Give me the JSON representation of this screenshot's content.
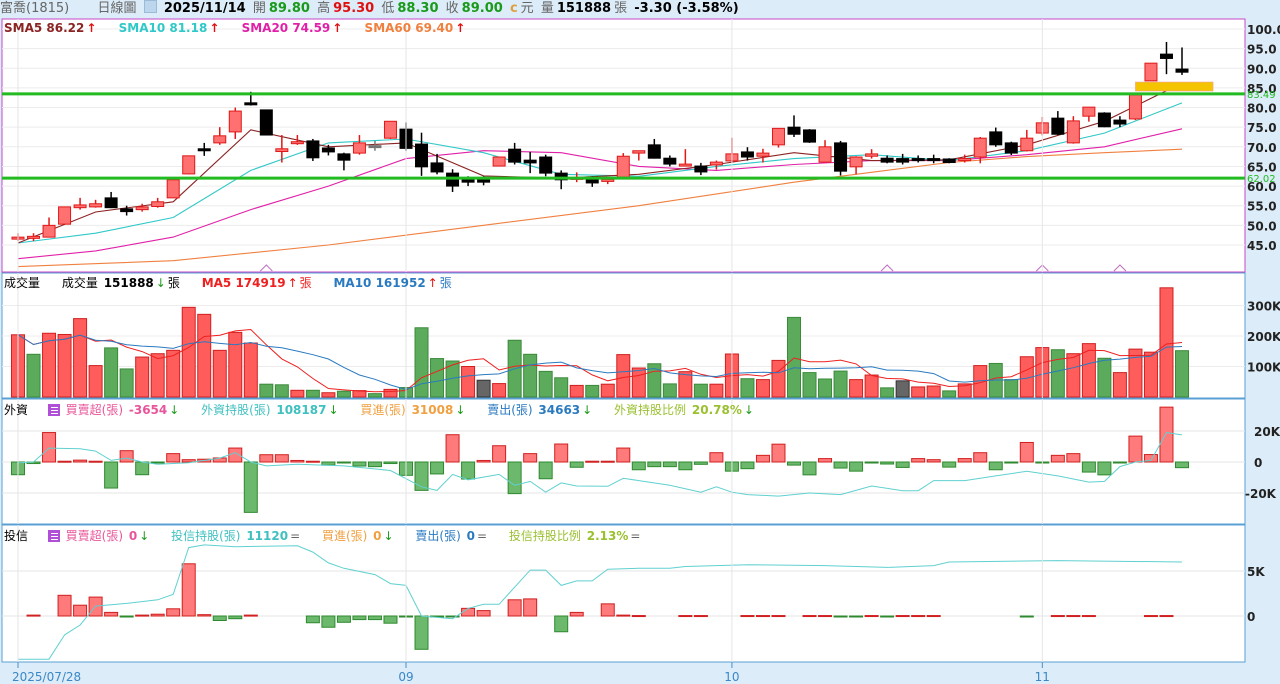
{
  "header": {
    "stock": "富喬(1815)",
    "chart_type": "日線圖",
    "date": "2025/11/14",
    "open_label": "開",
    "open": "89.80",
    "high_label": "高",
    "high": "95.30",
    "low_label": "低",
    "low": "88.30",
    "close_label": "收",
    "close": "89.00",
    "c_mark": "c",
    "unit": "元",
    "volume_label": "量",
    "volume": "151888",
    "volume_unit": "張",
    "change": "-3.30 (-3.58%)"
  },
  "price_legend": {
    "sma5": "SMA5 86.22",
    "sma5_arrow": "↑",
    "sma10": "SMA10 81.18",
    "sma10_arrow": "↑",
    "sma20": "SMA20 74.59",
    "sma20_arrow": "↑",
    "sma60": "SMA60 69.40",
    "sma60_arrow": "↑"
  },
  "volume_legend": {
    "title": "成交量",
    "label": "成交量",
    "value": "151888",
    "arrow": "↓",
    "unit": "張",
    "ma5": "MA5 174919",
    "ma5_arrow": "↑",
    "ma5_unit": "張",
    "ma10": "MA10 161952",
    "ma10_arrow": "↑",
    "ma10_unit": "張"
  },
  "foreign_legend": {
    "title": "外資",
    "net_label": "買賣超(張)",
    "net": "-3654",
    "net_arrow": "↓",
    "hold_label": "外資持股(張)",
    "hold": "108187",
    "hold_arrow": "↓",
    "buy_label": "買進(張)",
    "buy": "31008",
    "buy_arrow": "↓",
    "sell_label": "賣出(張)",
    "sell": "34663",
    "sell_arrow": "↓",
    "ratio_label": "外資持股比例",
    "ratio": "20.78%",
    "ratio_arrow": "↓"
  },
  "trust_legend": {
    "title": "投信",
    "net_label": "買賣超(張)",
    "net": "0",
    "net_arrow": "↓",
    "hold_label": "投信持股(張)",
    "hold": "11120",
    "hold_arrow": "=",
    "buy_label": "買進(張)",
    "buy": "0",
    "buy_arrow": "↓",
    "sell_label": "賣出(張)",
    "sell": "0",
    "sell_arrow": "=",
    "ratio_label": "投信持股比例",
    "ratio": "2.13%",
    "ratio_arrow": "="
  },
  "colors": {
    "up": "#ff7070",
    "up_border": "#e01818",
    "down": "#000000",
    "vol_up": "#ff5c5c",
    "vol_down": "#5cab5c",
    "vol_flat": "#666666",
    "sma5": "#8b2323",
    "sma10": "#30c8c8",
    "sma20": "#e020a8",
    "sma60": "#f08040",
    "support": "#22bb22",
    "zone": "#f5c400",
    "vma5": "#ee2020",
    "vma10": "#2a7ac0",
    "foreign_line": "#60d0d0",
    "trust_line": "#60d0d0"
  },
  "chart_data": {
    "type": "candlestick",
    "x_labels": [
      {
        "label": "2025/07/28",
        "candle": 1
      },
      {
        "label": "09",
        "candle": 26
      },
      {
        "label": "10",
        "candle": 47
      },
      {
        "label": "11",
        "candle": 67
      }
    ],
    "price_ticks": [
      "100.0",
      "95.0",
      "90.0",
      "85.0",
      "80.0",
      "75.0",
      "70.0",
      "65.0",
      "60.0",
      "55.0",
      "50.0",
      "45.0"
    ],
    "ylim": [
      40.3,
      101.5
    ],
    "support_lines": [
      {
        "label": "83.49",
        "value": 83.49
      },
      {
        "label": "62.02",
        "value": 62.02
      }
    ],
    "zone": {
      "from_candle": 73,
      "to_candle": 78,
      "low": 84.2,
      "high": 86.5
    },
    "markers": [
      17,
      57,
      67,
      72
    ],
    "ohlc": [
      [
        46.5,
        48,
        46,
        47
      ],
      [
        46.8,
        48,
        46,
        47.2
      ],
      [
        47,
        52,
        47,
        50
      ],
      [
        50.3,
        54.7,
        50.3,
        54.7
      ],
      [
        54.5,
        57,
        54,
        55.2
      ],
      [
        54.7,
        56.5,
        54.5,
        55.5
      ],
      [
        57,
        58.5,
        54.4,
        54.5
      ],
      [
        54.2,
        55,
        52.5,
        53.5
      ],
      [
        54,
        55.5,
        53.5,
        54.7
      ],
      [
        54.8,
        57,
        54.5,
        56
      ],
      [
        57,
        61.6,
        57,
        61.6
      ],
      [
        63.1,
        67.7,
        63,
        67.7
      ],
      [
        69.5,
        71,
        67.7,
        69.3
      ],
      [
        71,
        75,
        70.5,
        72.8
      ],
      [
        73.8,
        80,
        72,
        79.1
      ],
      [
        81.2,
        84,
        80.5,
        81
      ],
      [
        79.4,
        79.4,
        73,
        73
      ],
      [
        68.8,
        73,
        66,
        69.5
      ],
      [
        70.8,
        73,
        70.5,
        71.3
      ],
      [
        71.5,
        72,
        66.4,
        67.2
      ],
      [
        69.7,
        70.5,
        67.8,
        68.7
      ],
      [
        68.2,
        68.5,
        64,
        66.6
      ],
      [
        68.4,
        73,
        68,
        71
      ],
      [
        70.3,
        71.5,
        69,
        70.3
      ],
      [
        72.2,
        76.5,
        72,
        76.5
      ],
      [
        74.5,
        76.2,
        69,
        69.6
      ],
      [
        70.7,
        73.6,
        62.6,
        64.9
      ],
      [
        65.9,
        68.2,
        63,
        63.6
      ],
      [
        63.3,
        64.3,
        58.5,
        60
      ],
      [
        62,
        62.5,
        60,
        61
      ],
      [
        62.2,
        62.5,
        60.2,
        61
      ],
      [
        65.1,
        67.4,
        65,
        67.4
      ],
      [
        69.4,
        71,
        65.5,
        66.1
      ],
      [
        66.6,
        68.7,
        63.3,
        65.9
      ],
      [
        67.4,
        68,
        62.5,
        63.3
      ],
      [
        63.3,
        64,
        59.2,
        61.6
      ],
      [
        62,
        63.5,
        61,
        62.2
      ],
      [
        62.3,
        62.5,
        59.8,
        60.8
      ],
      [
        61.3,
        62,
        60.5,
        61.7
      ],
      [
        62.3,
        68.4,
        61.8,
        67.6
      ],
      [
        68.4,
        69,
        66.5,
        69
      ],
      [
        70.5,
        72,
        67,
        67.1
      ],
      [
        67.1,
        67.8,
        65,
        65.6
      ],
      [
        65.1,
        69.4,
        65,
        65.6
      ],
      [
        65.1,
        65.9,
        62.8,
        63.6
      ],
      [
        65.4,
        66.5,
        64.2,
        66.1
      ],
      [
        66.4,
        72.3,
        66,
        68.2
      ],
      [
        68.7,
        69.9,
        66.5,
        67.4
      ],
      [
        67.6,
        69.5,
        66,
        68.4
      ],
      [
        70.5,
        74.7,
        69.8,
        74.7
      ],
      [
        75,
        78,
        72.5,
        73.2
      ],
      [
        74.3,
        74.5,
        71,
        71.2
      ],
      [
        66.1,
        71.7,
        66,
        70
      ],
      [
        71,
        71.5,
        62.7,
        63.8
      ],
      [
        64.9,
        67.6,
        63,
        67.4
      ],
      [
        67.6,
        69.4,
        67,
        68.2
      ],
      [
        67.1,
        67.8,
        65.8,
        66.1
      ],
      [
        67,
        68.2,
        65.5,
        66.1
      ],
      [
        67,
        67.8,
        66,
        66.7
      ],
      [
        67,
        68,
        65.8,
        66.7
      ],
      [
        66.9,
        67.1,
        65.8,
        66
      ],
      [
        66.6,
        68,
        66,
        67
      ],
      [
        67.4,
        72.5,
        65.8,
        72.2
      ],
      [
        73.8,
        74.9,
        70,
        70.5
      ],
      [
        71,
        71.3,
        67.9,
        68.4
      ],
      [
        69,
        74.3,
        68.8,
        72.2
      ],
      [
        73.5,
        77.6,
        72.9,
        76.1
      ],
      [
        77.3,
        79.1,
        73,
        73.2
      ],
      [
        71,
        77.8,
        70.8,
        76.6
      ],
      [
        77.8,
        80.1,
        76.4,
        80.1
      ],
      [
        78.6,
        78.8,
        75,
        75.1
      ],
      [
        76.8,
        77.8,
        75,
        75.8
      ],
      [
        77.1,
        83.5,
        76.8,
        83.2
      ],
      [
        86.8,
        91.3,
        86.8,
        91.3
      ],
      [
        93.6,
        96.7,
        88.5,
        92.5
      ],
      [
        89.8,
        95.3,
        88.3,
        89
      ]
    ],
    "ma_keypoints": {
      "sma5": [
        [
          1,
          45.5
        ],
        [
          6,
          53.4
        ],
        [
          11,
          56
        ],
        [
          16,
          74.3
        ],
        [
          21,
          70
        ],
        [
          26,
          71
        ],
        [
          31,
          62.6
        ],
        [
          36,
          62
        ],
        [
          41,
          63
        ],
        [
          46,
          65.5
        ],
        [
          51,
          68.5
        ],
        [
          56,
          66.5
        ],
        [
          61,
          66.7
        ],
        [
          66,
          70.5
        ],
        [
          71,
          76.5
        ],
        [
          76,
          86.22
        ]
      ],
      "sma10": [
        [
          1,
          45.5
        ],
        [
          6,
          48
        ],
        [
          11,
          52
        ],
        [
          16,
          64
        ],
        [
          21,
          71
        ],
        [
          26,
          72
        ],
        [
          31,
          68.5
        ],
        [
          36,
          63
        ],
        [
          41,
          62.5
        ],
        [
          46,
          65
        ],
        [
          51,
          67
        ],
        [
          56,
          68
        ],
        [
          61,
          66.5
        ],
        [
          66,
          69
        ],
        [
          71,
          73.5
        ],
        [
          76,
          81.18
        ]
      ],
      "sma20": [
        [
          1,
          41.5
        ],
        [
          6,
          43.5
        ],
        [
          11,
          47
        ],
        [
          16,
          54
        ],
        [
          21,
          60
        ],
        [
          26,
          67
        ],
        [
          31,
          69
        ],
        [
          36,
          68.5
        ],
        [
          41,
          65
        ],
        [
          46,
          64
        ],
        [
          51,
          65.5
        ],
        [
          56,
          66.5
        ],
        [
          61,
          66.5
        ],
        [
          66,
          68
        ],
        [
          71,
          70
        ],
        [
          76,
          74.59
        ]
      ],
      "sma60": [
        [
          1,
          39.5
        ],
        [
          11,
          41
        ],
        [
          21,
          45
        ],
        [
          31,
          50
        ],
        [
          41,
          55
        ],
        [
          51,
          61
        ],
        [
          56,
          63.5
        ],
        [
          61,
          66
        ],
        [
          66,
          67.5
        ],
        [
          71,
          68.5
        ],
        [
          76,
          69.4
        ]
      ]
    },
    "volume_ticks": [
      "300K",
      "200K",
      "100K"
    ],
    "volume_k": [
      204,
      140,
      209,
      205,
      257,
      103,
      161,
      92,
      131,
      142,
      153,
      294,
      271,
      153,
      212,
      177,
      42,
      40,
      22,
      22,
      14,
      19,
      21,
      11,
      25,
      31,
      227,
      126,
      118,
      100,
      55,
      44,
      186,
      140,
      84,
      63,
      38,
      38,
      42,
      139,
      95,
      109,
      43,
      83,
      42,
      42,
      141,
      60,
      57,
      120,
      261,
      80,
      59,
      85,
      57,
      72,
      30,
      53,
      33,
      36,
      20,
      43,
      103,
      110,
      57,
      132,
      162,
      155,
      142,
      175,
      127,
      80,
      157,
      147,
      358,
      151.888
    ],
    "volume_color": [
      "r",
      "g",
      "r",
      "r",
      "r",
      "r",
      "g",
      "g",
      "r",
      "r",
      "r",
      "r",
      "r",
      "r",
      "r",
      "r",
      "g",
      "g",
      "r",
      "g",
      "r",
      "g",
      "r",
      "g",
      "r",
      "g",
      "g",
      "g",
      "g",
      "r",
      "k",
      "r",
      "g",
      "g",
      "g",
      "g",
      "r",
      "g",
      "r",
      "r",
      "r",
      "g",
      "g",
      "r",
      "g",
      "r",
      "r",
      "g",
      "r",
      "r",
      "g",
      "g",
      "g",
      "g",
      "r",
      "r",
      "g",
      "k",
      "r",
      "r",
      "g",
      "r",
      "r",
      "g",
      "g",
      "r",
      "r",
      "g",
      "r",
      "r",
      "g",
      "r",
      "r",
      "r",
      "r",
      "g"
    ],
    "foreign_ticks": [
      "20K",
      "0",
      "-20K"
    ],
    "foreign_net_k": [
      -8.2,
      -1,
      19,
      0.5,
      1.2,
      0.5,
      -16.8,
      7.3,
      -8.2,
      -0.3,
      5.4,
      1.5,
      1.8,
      2.6,
      9,
      -32.5,
      4.7,
      4.7,
      1,
      0.5,
      -2,
      -0.5,
      -2.6,
      -3,
      -1,
      -8.6,
      -18.3,
      -7.7,
      17.6,
      -11,
      1,
      10.5,
      -20.4,
      5.4,
      -10.8,
      11.6,
      -3.4,
      0.5,
      0.5,
      9,
      -5,
      -3,
      -3,
      -5,
      -1.5,
      6,
      -5.9,
      -4.3,
      4.3,
      11.5,
      -2,
      -8.3,
      2.2,
      -3.9,
      -5.9,
      -0.3,
      -1.3,
      -3.5,
      2.2,
      1.5,
      -3.3,
      2.2,
      6,
      -5,
      -0.3,
      12.6,
      -0.3,
      4.3,
      5.4,
      -6.5,
      -8.3,
      -0.3,
      16.7,
      4.8,
      35.4,
      -3.654
    ],
    "foreign_hold_keypoints": [
      [
        1,
        -0.5
      ],
      [
        2,
        0
      ],
      [
        3,
        9
      ],
      [
        5,
        8.5
      ],
      [
        6,
        7
      ],
      [
        7,
        1
      ],
      [
        8,
        2.5
      ],
      [
        9,
        0
      ],
      [
        10,
        -1.5
      ],
      [
        12,
        -0.5
      ],
      [
        14,
        2.5
      ],
      [
        15,
        6
      ],
      [
        16,
        0
      ],
      [
        17,
        -2.5
      ],
      [
        19,
        -1.5
      ],
      [
        22,
        -2.5
      ],
      [
        25,
        -5.5
      ],
      [
        27,
        -16
      ],
      [
        28,
        -18.3
      ],
      [
        29,
        -8
      ],
      [
        30,
        -11.5
      ],
      [
        32,
        -8
      ],
      [
        33,
        -15
      ],
      [
        34,
        -12.5
      ],
      [
        35,
        -19.5
      ],
      [
        36,
        -13.5
      ],
      [
        37,
        -15.5
      ],
      [
        39,
        -15.7
      ],
      [
        40,
        -10.5
      ],
      [
        41,
        -12
      ],
      [
        43,
        -15
      ],
      [
        45,
        -19.5
      ],
      [
        46,
        -16
      ],
      [
        47,
        -19.5
      ],
      [
        48,
        -21
      ],
      [
        50,
        -22
      ],
      [
        52,
        -20
      ],
      [
        54,
        -21
      ],
      [
        56,
        -15.5
      ],
      [
        58,
        -18.5
      ],
      [
        59,
        -18.5
      ],
      [
        60,
        -12
      ],
      [
        62,
        -12
      ],
      [
        64,
        -9
      ],
      [
        66,
        -6
      ],
      [
        68,
        -9
      ],
      [
        70,
        -13
      ],
      [
        71,
        -12.5
      ],
      [
        72,
        -3
      ],
      [
        73,
        0
      ],
      [
        74,
        1
      ],
      [
        75,
        19
      ],
      [
        76,
        17.5
      ]
    ],
    "trust_ticks": [
      "5K",
      "0"
    ],
    "trust_net_k": [
      0,
      0.1,
      0,
      2.3,
      1.2,
      2.1,
      0.4,
      -0.05,
      0.1,
      0.2,
      0.8,
      5.8,
      0.15,
      -0.5,
      -0.3,
      0.1,
      0,
      0,
      0,
      -0.75,
      -1.25,
      -0.7,
      -0.4,
      -0.4,
      -0.8,
      -0.05,
      -3.7,
      -0.05,
      -0.05,
      0.85,
      0.6,
      0,
      1.8,
      1.9,
      0,
      -1.75,
      0.4,
      0,
      1.35,
      0.1,
      0.05,
      0,
      0,
      0.05,
      0.05,
      0,
      0,
      0.05,
      0.05,
      0.05,
      0,
      0.05,
      0.05,
      -0.05,
      -0.05,
      0.05,
      -0.05,
      0.05,
      0.05,
      0.05,
      0,
      0,
      0,
      0,
      0,
      -0.05,
      0,
      0.05,
      0.05,
      0.05,
      0,
      0,
      0,
      0.05,
      0.05,
      0
    ],
    "trust_hold_keypoints": [
      [
        1,
        -4.8
      ],
      [
        3,
        -4.8
      ],
      [
        4,
        -2.1
      ],
      [
        5,
        -1
      ],
      [
        6,
        1.1
      ],
      [
        8,
        1.4
      ],
      [
        10,
        1.8
      ],
      [
        11,
        2.4
      ],
      [
        12,
        7.6
      ],
      [
        13,
        7.9
      ],
      [
        15,
        7.7
      ],
      [
        19,
        7.8
      ],
      [
        20,
        7.1
      ],
      [
        21,
        5.9
      ],
      [
        22,
        5.3
      ],
      [
        24,
        4.6
      ],
      [
        25,
        3.6
      ],
      [
        26,
        3.4
      ],
      [
        27,
        0
      ],
      [
        29,
        -0.3
      ],
      [
        30,
        0.85
      ],
      [
        31,
        1.3
      ],
      [
        32,
        1.3
      ],
      [
        34,
        5.1
      ],
      [
        35,
        5.1
      ],
      [
        36,
        3.4
      ],
      [
        37,
        3.9
      ],
      [
        38,
        3.9
      ],
      [
        39,
        5.2
      ],
      [
        41,
        5.3
      ],
      [
        43,
        5.3
      ],
      [
        44,
        5.5
      ],
      [
        48,
        5.7
      ],
      [
        53,
        5.6
      ],
      [
        57,
        5.4
      ],
      [
        60,
        5.6
      ],
      [
        61,
        6.0
      ],
      [
        68,
        6.15
      ],
      [
        76,
        6.0
      ]
    ]
  }
}
